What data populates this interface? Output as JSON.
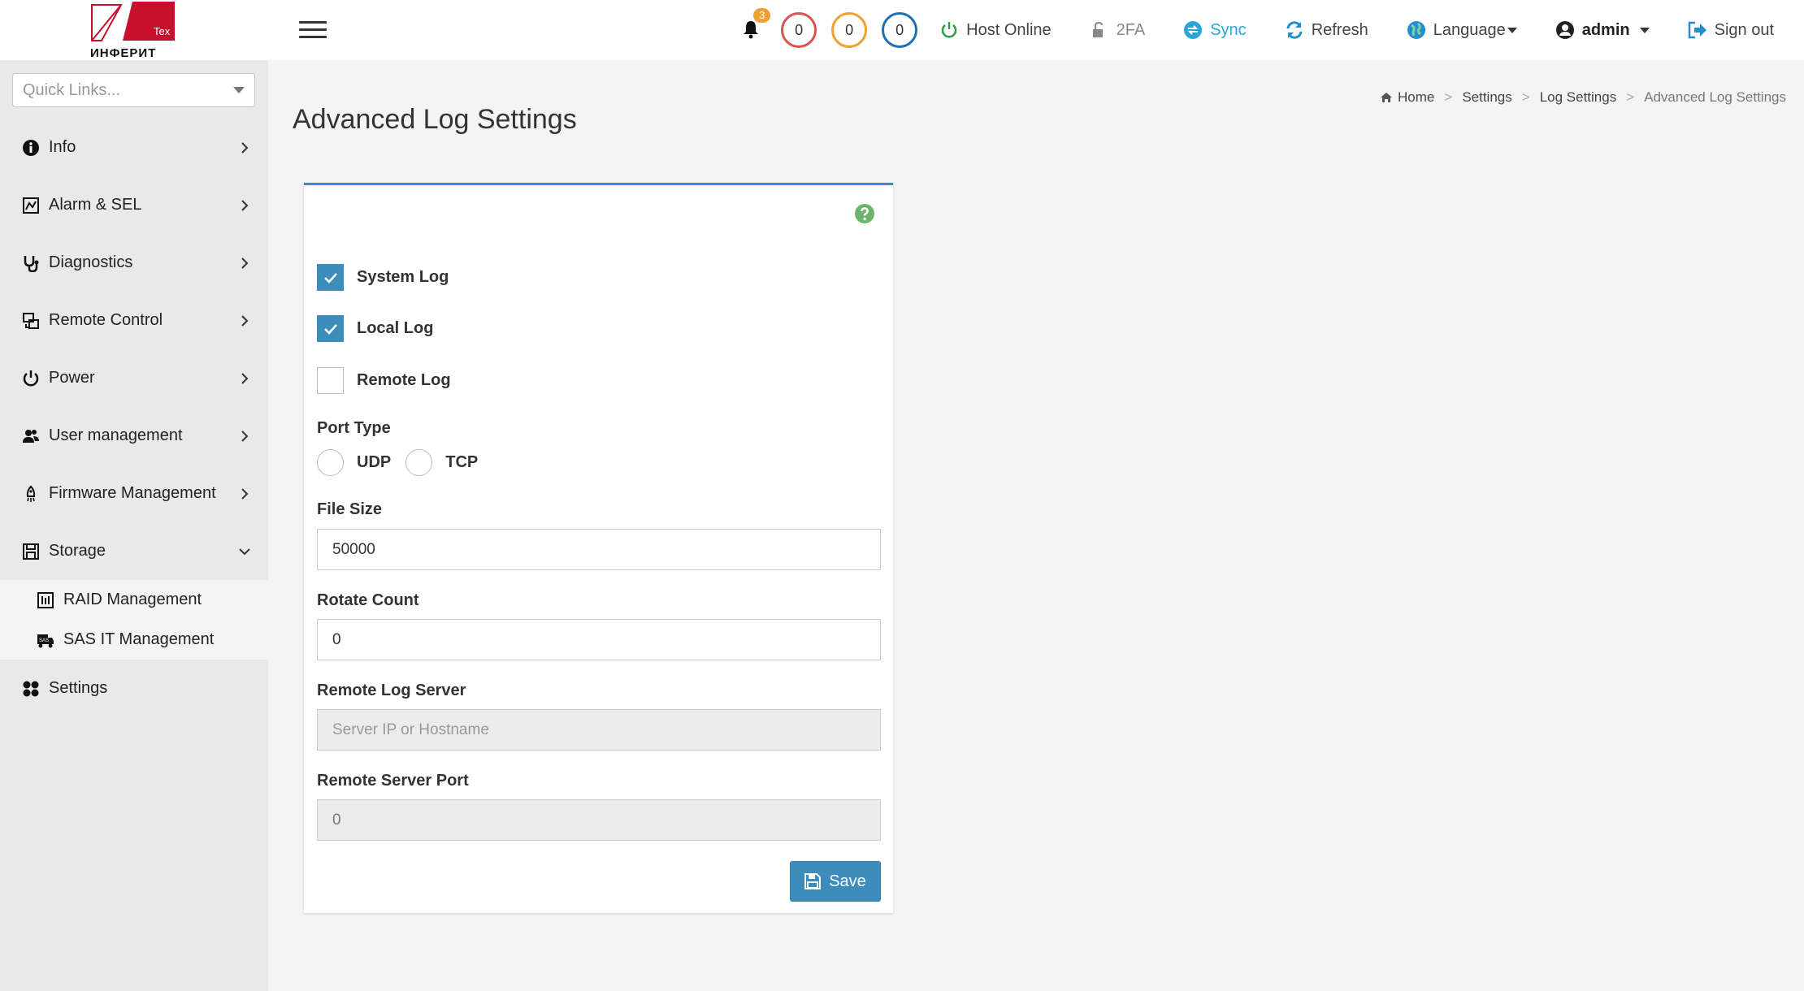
{
  "brand": {
    "logo_text": "ИНФЕРИТ",
    "logo_badge": "Tex"
  },
  "sidebar": {
    "quick_links_placeholder": "Quick Links...",
    "items": [
      {
        "label": "Info",
        "icon": "info-icon"
      },
      {
        "label": "Alarm & SEL",
        "icon": "alarm-icon"
      },
      {
        "label": "Diagnostics",
        "icon": "stethoscope-icon"
      },
      {
        "label": "Remote Control",
        "icon": "remote-control-icon"
      },
      {
        "label": "Power",
        "icon": "power-icon"
      },
      {
        "label": "User management",
        "icon": "users-icon"
      },
      {
        "label": "Firmware Management",
        "icon": "rocket-icon"
      },
      {
        "label": "Storage",
        "icon": "storage-icon",
        "expanded": true
      },
      {
        "label": "Settings",
        "icon": "settings-icon"
      }
    ],
    "storage_sub": [
      {
        "label": "RAID Management",
        "icon": "raid-icon"
      },
      {
        "label": "SAS IT Management",
        "icon": "sas-icon"
      }
    ]
  },
  "topbar": {
    "notifications_count": "3",
    "counter_red": "0",
    "counter_orange": "0",
    "counter_blue": "0",
    "host_status": "Host Online",
    "twofa": "2FA",
    "sync": "Sync",
    "refresh": "Refresh",
    "language": "Language",
    "user": "admin",
    "signout": "Sign out",
    "colors": {
      "red": "#d9534f",
      "orange": "#f0a030",
      "blue": "#1f6fb2",
      "online": "#2e9e3e",
      "sync": "#29a6d8"
    }
  },
  "breadcrumb": {
    "home": "Home",
    "settings": "Settings",
    "log_settings": "Log Settings",
    "current": "Advanced Log Settings"
  },
  "page": {
    "title": "Advanced Log Settings"
  },
  "form": {
    "system_log": {
      "label": "System Log",
      "checked": true
    },
    "local_log": {
      "label": "Local Log",
      "checked": true
    },
    "remote_log": {
      "label": "Remote Log",
      "checked": false
    },
    "port_type_label": "Port Type",
    "udp_label": "UDP",
    "tcp_label": "TCP",
    "file_size_label": "File Size",
    "file_size_value": "50000",
    "rotate_count_label": "Rotate Count",
    "rotate_count_value": "0",
    "remote_server_label": "Remote Log Server",
    "remote_server_placeholder": "Server IP or Hostname",
    "remote_port_label": "Remote Server Port",
    "remote_port_value": "0",
    "save_label": "Save"
  }
}
